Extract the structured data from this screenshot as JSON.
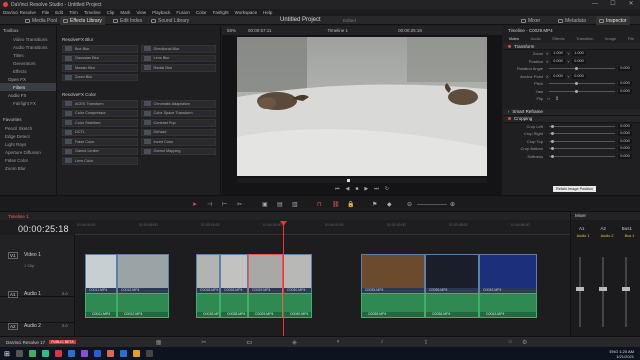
{
  "titlebar": {
    "app_title": "DaVinci Resolve Studio - Untitled Project",
    "min": "—",
    "max": "☐",
    "close": "✕"
  },
  "menu": [
    "DaVinci Resolve",
    "File",
    "Edit",
    "Trim",
    "Timeline",
    "Clip",
    "Mark",
    "View",
    "Playback",
    "Fusion",
    "Color",
    "Fairlight",
    "Workspace",
    "Help"
  ],
  "toolbar": {
    "media_pool": "Media Pool",
    "effects_library": "Effects Library",
    "edit_index": "Edit Index",
    "sound_library": "Sound Library",
    "mixer": "Mixer",
    "metadata": "Metadata",
    "inspector": "Inspector"
  },
  "project": {
    "title": "Untitled Project",
    "status": "Edited"
  },
  "leftnav": {
    "toolbox": "Toolbox",
    "toolbox_items": [
      "Video Transitions",
      "Audio Transitions",
      "Titles",
      "Generators",
      "Effects"
    ],
    "open_fx": "Open FX",
    "filters": "Filters",
    "audio_fx": "Audio FX",
    "fairlight_fx": "Fairlight FX",
    "favorites": "Favorites",
    "favorites_items": [
      "Pencil Sketch",
      "Edge Detect",
      "Light Rays",
      "Aperture Diffusion",
      "False Color",
      "Zoom Blur"
    ]
  },
  "fx": {
    "blur_header": "ResolveFX Blur",
    "blur_items": [
      "Box Blur",
      "Directional Blur",
      "Gaussian Blur",
      "Lens Blur",
      "Mosaic Blur",
      "Radial Blur",
      "Zoom Blur"
    ],
    "color_header": "ResolveFX Color",
    "color_items": [
      "ACES Transform",
      "Chromatic Adaptation",
      "Color Compressor",
      "Color Space Transform",
      "Color Stabilizer",
      "Contrast Pop",
      "DCTL",
      "Dehaze",
      "False Color",
      "Invert Color",
      "Gamut Limiter",
      "Gamut Mapping",
      "Lens Color"
    ]
  },
  "viewer": {
    "zoom": "58%",
    "source_tc": "00:00:57:11",
    "timeline_name": "Timeline 1",
    "tc": "00:00:25:18"
  },
  "inspector": {
    "clip_name": "Timeline - C0029.MP4",
    "tabs": [
      "Video",
      "Audio",
      "Effects",
      "Transition",
      "Image",
      "File"
    ],
    "transform": "Transform",
    "rows": [
      {
        "label": "Zoom",
        "x": "1.000",
        "y": "1.000"
      },
      {
        "label": "Position",
        "x": "0.000",
        "y": "0.000"
      },
      {
        "label": "Rotation Angle",
        "x": "0.000",
        "y": ""
      },
      {
        "label": "Anchor Point",
        "x": "0.000",
        "y": "0.000"
      },
      {
        "label": "Pitch",
        "x": "0.000",
        "y": ""
      },
      {
        "label": "Yaw",
        "x": "0.000",
        "y": ""
      },
      {
        "label": "Flip",
        "x": "",
        "y": ""
      }
    ],
    "smart_reframe": "Smart Reframe",
    "cropping": "Cropping",
    "crop_rows": [
      {
        "label": "Crop Left",
        "x": "0.000"
      },
      {
        "label": "Crop Right",
        "x": "0.000"
      },
      {
        "label": "Crop Top",
        "x": "0.000"
      },
      {
        "label": "Crop Bottom",
        "x": "0.000"
      },
      {
        "label": "Softness",
        "x": "0.000"
      }
    ],
    "tooltip": "Retain Image Position"
  },
  "timeline": {
    "name": "Timeline 1",
    "timecode": "00:00:25:18",
    "ruler": [
      "01:00:00:00",
      "01:00:08:00",
      "01:00:16:00",
      "01:00:24:00",
      "01:00:32:00",
      "01:00:40:00",
      "01:00:48:00",
      "01:00:56:00"
    ],
    "tracks": [
      {
        "id": "V1",
        "name": "Video 1",
        "clips": "1 Clip"
      },
      {
        "id": "A1",
        "name": "Audio 1",
        "level": "2.0"
      },
      {
        "id": "A2",
        "name": "Audio 2",
        "level": "2.0"
      }
    ],
    "audio_clips": [
      "C0011.MP4",
      "C0012.MP4",
      "C0018.MP4",
      "C0028.MP4",
      "C0029.MP4",
      "C0030.MP4",
      "C0035.MP4",
      "C0036.MP4",
      "C0043.MP4"
    ],
    "video_clips": [
      "C0011.MP4",
      "C0012.MP4",
      "C0018.MP4",
      "C0028.MP4",
      "C0029.MP4",
      "C0030.MP4",
      "C0035.MP4",
      "C0036.MP4",
      "C0043.MP4"
    ]
  },
  "mixer": {
    "title": "Mixer",
    "channels": [
      "A1",
      "A2",
      "Bus1"
    ],
    "labels": [
      "Audio 1",
      "Audio 2",
      "Bus 1"
    ]
  },
  "resolve": {
    "version": "DaVinci Resolve 17",
    "badge": "PUBLIC BETA"
  },
  "clock": {
    "time": "1:20 AM",
    "date": "1/21/2021",
    "lang": "ENG"
  }
}
